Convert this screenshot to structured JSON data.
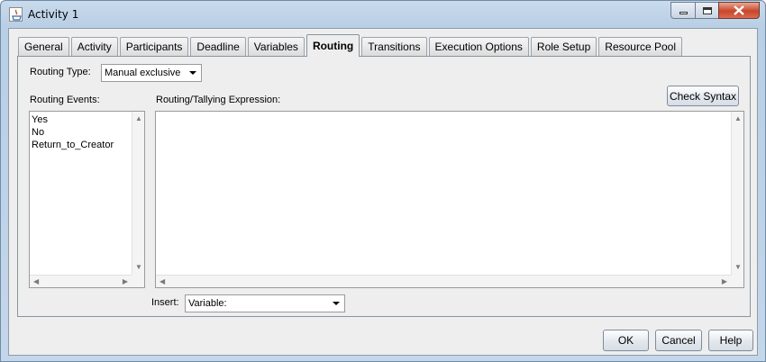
{
  "window": {
    "title": "Activity 1"
  },
  "tabs": [
    {
      "label": "General"
    },
    {
      "label": "Activity"
    },
    {
      "label": "Participants"
    },
    {
      "label": "Deadline"
    },
    {
      "label": "Variables"
    },
    {
      "label": "Routing",
      "active": true
    },
    {
      "label": "Transitions"
    },
    {
      "label": "Execution Options"
    },
    {
      "label": "Role Setup"
    },
    {
      "label": "Resource Pool"
    }
  ],
  "routing": {
    "type_label": "Routing Type:",
    "type_value": "Manual exclusive",
    "events_label": "Routing Events:",
    "events": [
      "Yes",
      "No",
      "Return_to_Creator"
    ],
    "expression_label": "Routing/Tallying Expression:",
    "expression_value": "",
    "check_syntax": "Check Syntax",
    "insert_label": "Insert:",
    "insert_value": "Variable:"
  },
  "footer": {
    "ok": "OK",
    "cancel": "Cancel",
    "help": "Help"
  },
  "colors": {
    "frame": "#c4d6ea",
    "client": "#eeeeee",
    "close_button": "#c8462b"
  }
}
